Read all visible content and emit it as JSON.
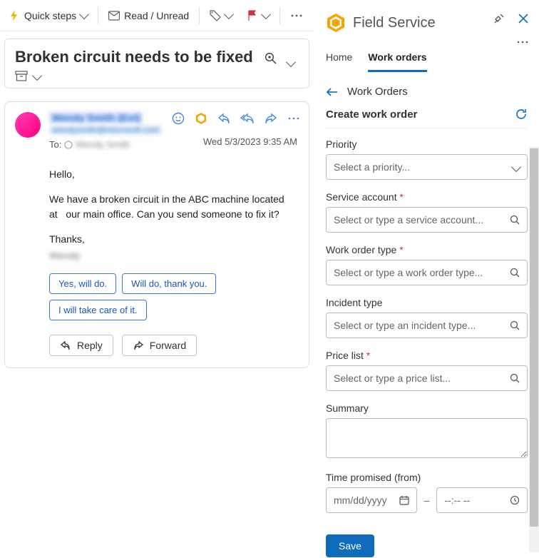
{
  "toolbar": {
    "quick_steps": "Quick steps",
    "read_unread": "Read / Unread"
  },
  "email": {
    "subject": "Broken circuit needs to be fixed",
    "from_name": "Wendy Smith (Ext)",
    "from_email": "wendysmith@microsoft.com",
    "to_label": "To:",
    "to_name": "Wendy Smith",
    "date": "Wed 5/3/2023 9:35 AM",
    "body_greeting": "Hello,",
    "body_main": "We have a broken circuit in the ABC machine located at   our main office. Can you send someone to fix it?",
    "body_closing": "Thanks,",
    "body_sig": "Wendy",
    "suggestions": [
      "Yes, will do.",
      "Will do, thank you.",
      "I will take care of it."
    ],
    "reply_label": "Reply",
    "forward_label": "Forward"
  },
  "panel": {
    "app_title": "Field Service",
    "tabs": {
      "home": "Home",
      "work_orders": "Work orders"
    },
    "breadcrumb": "Work Orders",
    "create_title": "Create work order",
    "fields": {
      "priority": {
        "label": "Priority",
        "placeholder": "Select a priority..."
      },
      "service_account": {
        "label": "Service account",
        "placeholder": "Select or type a service account..."
      },
      "work_order_type": {
        "label": "Work order type",
        "placeholder": "Select or type a work order type..."
      },
      "incident_type": {
        "label": "Incident type",
        "placeholder": "Select or type an incident type..."
      },
      "price_list": {
        "label": "Price list",
        "placeholder": "Select or type a price list..."
      },
      "summary": {
        "label": "Summary"
      },
      "time_promised": {
        "label": "Time promised (from)",
        "date_placeholder": "mm/dd/yyyy",
        "time_placeholder": "--:--  --"
      }
    },
    "save_label": "Save"
  },
  "icons": {
    "quick_steps": "lightning-icon",
    "envelope": "envelope-icon",
    "tag": "tag-icon",
    "flag": "flag-icon",
    "more": "more-icon",
    "zoom": "zoom-icon",
    "smiley": "smiley-icon",
    "fs_badge": "fs-badge-icon",
    "reply": "reply-icon",
    "reply_all": "reply-all-icon",
    "forward": "forward-icon",
    "pin": "pin-icon",
    "close": "close-icon",
    "refresh": "refresh-icon",
    "search": "search-icon",
    "chevron_down": "chevron-down-icon",
    "calendar": "calendar-icon",
    "clock": "clock-icon",
    "archive": "archive-icon",
    "back": "back-icon",
    "presence": "presence-indicator"
  }
}
